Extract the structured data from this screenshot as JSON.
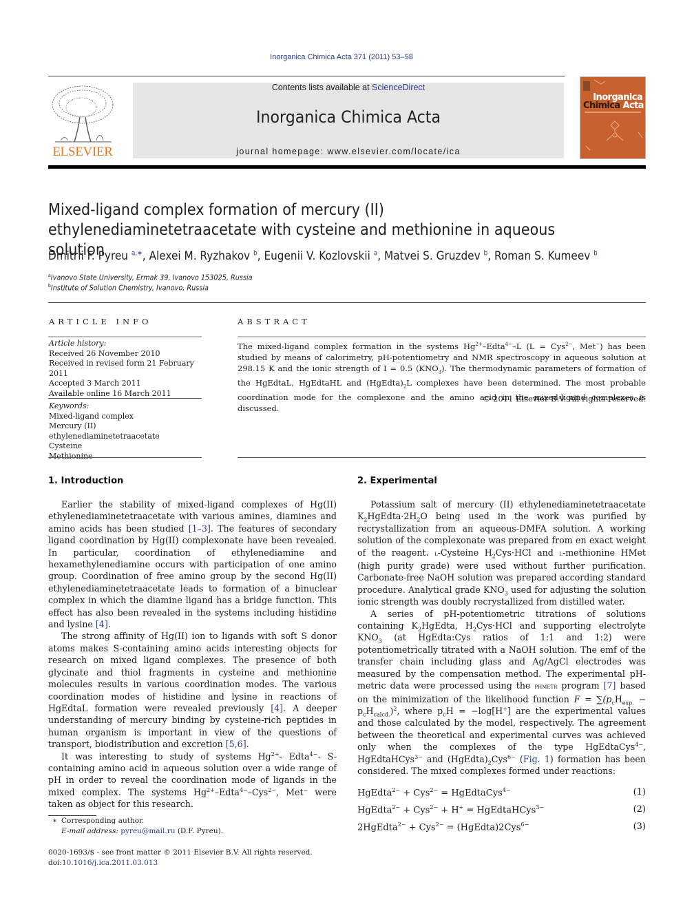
{
  "header": {
    "citation": "Inorganica Chimica Acta 371 (2011) 53–58",
    "contents_prefix": "Contents lists available at ",
    "contents_link": "ScienceDirect",
    "journal_name": "Inorganica Chimica Acta",
    "homepage": "journal homepage: www.elsevier.com/locate/ica",
    "publisher_logo_text": "ELSEVIER",
    "cover_title_1": "Inorganica",
    "cover_title_2a": "Chimica",
    "cover_title_2b": "Acta",
    "colors": {
      "publisher_orange": "#e87722",
      "cover_orange": "#c9612f",
      "link_blue": "#2a3a8c",
      "banner_gray": "#e6e6e6"
    }
  },
  "article": {
    "title": "Mixed-ligand complex formation of mercury (II) ethylenediaminetetraacetate with cysteine and methionine in aqueous solution",
    "authors": [
      {
        "name": "Dmitrii F. Pyreu",
        "aff": "a,∗",
        "sep": ", "
      },
      {
        "name": "Alexei M. Ryzhakov",
        "aff": "b",
        "sep": ", "
      },
      {
        "name": "Eugenii V. Kozlovskii",
        "aff": "a",
        "sep": ", "
      },
      {
        "name": "Matvei S. Gruzdev",
        "aff": "b",
        "sep": ", "
      },
      {
        "name": "Roman S. Kumeev",
        "aff": "b",
        "sep": ""
      }
    ],
    "affiliations": [
      {
        "mark": "a",
        "text": "Ivanovo State University, Ermak 39, Ivanovo 153025, Russia"
      },
      {
        "mark": "b",
        "text": "Institute of Solution Chemistry, Ivanovo, Russia"
      }
    ]
  },
  "article_info": {
    "heading": "ARTICLE INFO",
    "history_label": "Article history:",
    "history": [
      "Received 26 November 2010",
      "Received in revised form 21 February 2011",
      "Accepted 3 March 2011",
      "Available online 16 March 2011"
    ],
    "keywords_label": "Keywords:",
    "keywords": [
      "Mixed-ligand complex",
      "Mercury (II) ethylenediaminetetraacetate",
      "Cysteine",
      "Methionine"
    ]
  },
  "abstract": {
    "heading": "ABSTRACT",
    "t1": "The mixed-ligand complex formation in the systems Hg",
    "t2": "–Edta",
    "t3": "–L (L = Cys",
    "t4": ", Met",
    "t5": ") has been studied by means of calorimetry, pH-potentiometry and NMR spectroscopy in aqueous solution at 298.15 K and the ionic strength of I = 0.5 (KNO",
    "t6": "). The thermodynamic parameters of formation of the HgEdtaL, HgEdtaHL and (HgEdta)",
    "t7": "L complexes have been determined. The most probable coordination mode for the complexone and the amino acid in the mixed-ligand complexes is discussed.",
    "copyright": "© 2011 Elsevier B.V. All rights reserved."
  },
  "intro": {
    "heading": "1. Introduction",
    "p1a": "Earlier the stability of mixed-ligand complexes of Hg(II) ethylenediaminetetraacetate with various amines, diamines and amino acids has been studied ",
    "p1_ref1": "[1–3]",
    "p1b": ". The features of secondary ligand coordination by Hg(II) complexonate have been revealed. In particular, coordination of ethylenediamine and hexamethylenediamine occurs with participation of one amino group. Coordination of free amino group by the second Hg(II) ethylenediaminetetraacetate leads to formation of a binuclear complex in which the diamine ligand has a bridge function. This effect has also been revealed in the systems including histidine and lysine ",
    "p1_ref2": "[4]",
    "p1c": ".",
    "p2a": "The strong affinity of Hg(II) ion to ligands with soft S donor atoms makes S-containing amino acids interesting objects for research on mixed ligand complexes. The presence of both glycinate and thiol fragments in cysteine and methionine molecules results in various coordination modes. The various coordination modes of histidine and lysine in reactions of HgEdtaL formation were revealed previously ",
    "p2_ref1": "[4]",
    "p2b": ". A deeper understanding of mercury binding by cysteine-rich peptides in human organism is important in view of the questions of transport, biodistribution and excretion ",
    "p2_ref2": "[5,6]",
    "p2c": ".",
    "p3a": "It was interesting to study of systems Hg",
    "p3b": "- Edta",
    "p3c": "- S-containing amino acid in aqueous solution over a wide range of pH in order to reveal the coordination mode of ligands in the mixed complex. The systems Hg",
    "p3d": "–Edta",
    "p3e": "–Cys",
    "p3f": ", Met",
    "p3g": " were taken as object for this research."
  },
  "experimental": {
    "heading": "2. Experimental",
    "p1a": "Potassium salt of mercury (II) ethylenediaminetetraacetate K",
    "p1b": "HgEdta·2H",
    "p1c": "O being used in the work was purified by recrystallization from an aqueous-DMFA solution. A working solution of the complexonate was prepared from en exact weight of the reagent. ",
    "p1d": "l",
    "p1e": "-Cysteine H",
    "p1f": "Cys·HCl and ",
    "p1g": "l",
    "p1h": "-methionine HMet (high purity grade) were used without further purification. Carbonate-free NaOH solution was prepared according standard procedure. Analytical grade KNO",
    "p1i": " used for adjusting the solution ionic strength was doubly recrystallized from distilled water.",
    "p2a": "A series of pH-potentiometric titrations of solutions containing K",
    "p2b": "HgEdta, H",
    "p2c": "Cys·HCl and supporting electrolyte KNO",
    "p2d": " (at HgEdta:Cys ratios of 1:1 and 1:2) were potentiometrically titrated with a NaOH solution. The emf of the transfer chain including glass and Ag/AgCl electrodes was measured by the compensation method. The experimental pH-metric data were processed using the ",
    "p2_prog": "phmetr",
    "p2e": " program ",
    "p2_ref": "[7]",
    "p2f": " based on the minimization of the likelihood function ",
    "p2_F": "F = ∑(p",
    "p2_g": "H",
    "p2_h": " − p",
    "p2_i": "H",
    "p2_j": ")",
    "p2_k": ",  where  p",
    "p2_l": "H = −log[H",
    "p2_m": "] are the experimental values and those calculated by the model, respectively. The agreement between the theoretical and experimental curves was achieved only when the complexes of the type HgEdtaCys",
    "p2_n": ", HgEdtaHCys",
    "p2_o": " and (HgEdta)",
    "p2_p": "Cys",
    "p2_q": " (",
    "p2_fig": "Fig. 1",
    "p2_r": ") formation has been considered. The mixed complexes formed under reactions:",
    "sub_c": "c",
    "sub_exp": "exp.",
    "sub_calcd": "calcd.",
    "sub_2": "2",
    "sub_3": "3",
    "sup_2": "2",
    "sup_plus": "+",
    "sup_4m": "4−",
    "sup_3m": "3−",
    "sup_6m": "6−",
    "equations": [
      {
        "lhs": "HgEdta",
        "lhs_sup": "2−",
        "mid": " + Cys",
        "mid_sup": "2−",
        "rest": " + ",
        "rest_show": false,
        "h": "",
        "rhs": " = HgEdtaCys",
        "rhs_sup": "4−",
        "num": "(1)"
      },
      {
        "lhs": "HgEdta",
        "lhs_sup": "2−",
        "mid": " + Cys",
        "mid_sup": "2−",
        "h": " + H",
        "h_sup": "+",
        "rhs": " = HgEdtaHCys",
        "rhs_sup": "3−",
        "num": "(2)"
      },
      {
        "lhs": "2HgEdta",
        "lhs_sup": "2−",
        "mid": " + Cys",
        "mid_sup": "2−",
        "h": "",
        "rhs": " = (HgEdta)2Cys",
        "rhs_sup": "6−",
        "num": "(3)"
      }
    ]
  },
  "footnotes": {
    "mark": "∗",
    "corresponding": "Corresponding author.",
    "email_label": "E-mail address: ",
    "email": "pyreu@mail.ru",
    "email_suffix": " (D.F. Pyreu).",
    "front_matter": "0020-1693/$ - see front matter © 2011 Elsevier B.V. All rights reserved.",
    "doi_label": "doi:",
    "doi": "10.1016/j.ica.2011.03.013"
  },
  "superscripts": {
    "hg": "2+",
    "edta": "4−",
    "cys": "2−",
    "met": "−",
    "sub3": "3",
    "sub2": "2"
  }
}
